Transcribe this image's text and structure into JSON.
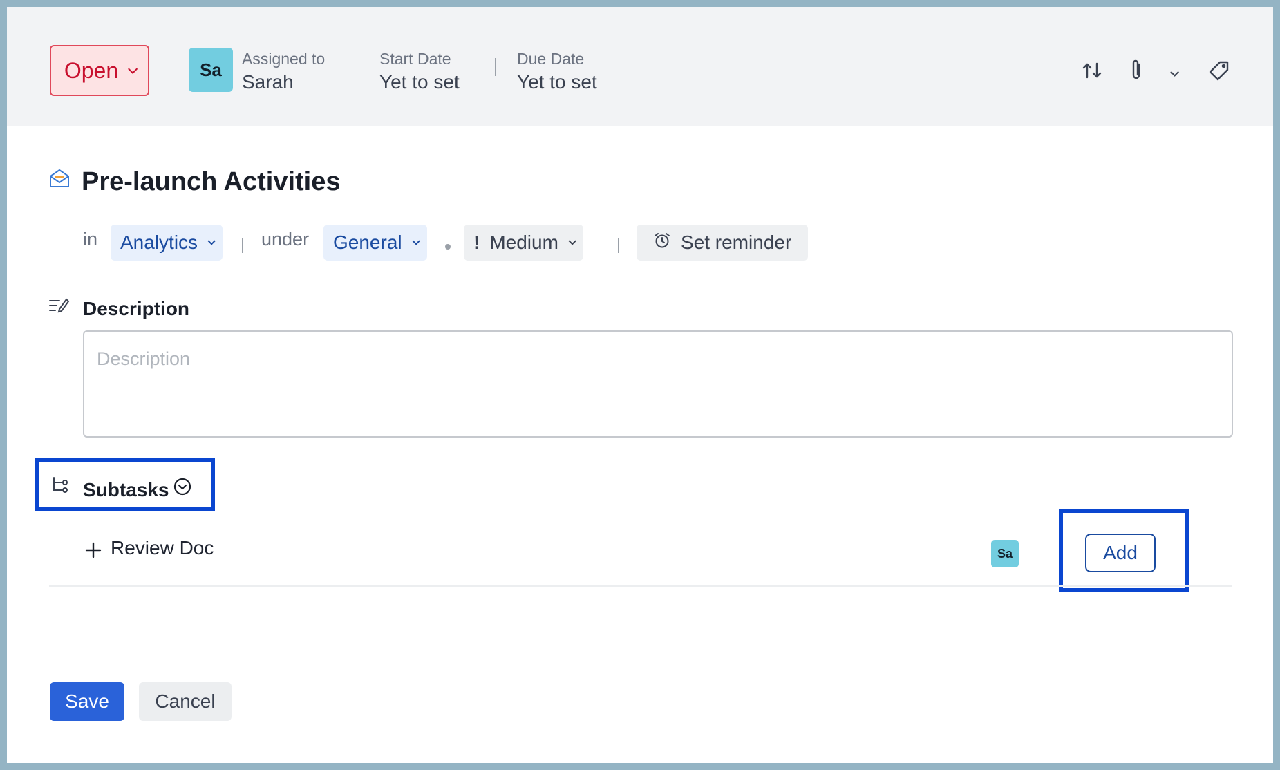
{
  "header": {
    "status_label": "Open",
    "assignee_avatar": "Sa",
    "assigned_label": "Assigned to",
    "assignee_name": "Sarah",
    "start_label": "Start Date",
    "start_value": "Yet to set",
    "due_label": "Due Date",
    "due_value": "Yet to set",
    "icons": [
      "swap-icon",
      "paperclip-icon",
      "chevron-down-icon",
      "tag-icon"
    ]
  },
  "task": {
    "title": "Pre-launch Activities",
    "in_label": "in",
    "project": "Analytics",
    "under_label": "under",
    "tasklist": "General",
    "priority": "Medium",
    "reminder": "Set reminder"
  },
  "description": {
    "label": "Description",
    "placeholder": "Description",
    "value": ""
  },
  "subtasks": {
    "label": "Subtasks",
    "new_subtask_value": "Review Doc",
    "assignee_avatar": "Sa",
    "add_label": "Add"
  },
  "footer": {
    "save_label": "Save",
    "cancel_label": "Cancel"
  },
  "colors": {
    "status": "#c8102e",
    "accent": "#2a62d9",
    "highlight": "#0a46d0",
    "avatar": "#72cde0"
  }
}
